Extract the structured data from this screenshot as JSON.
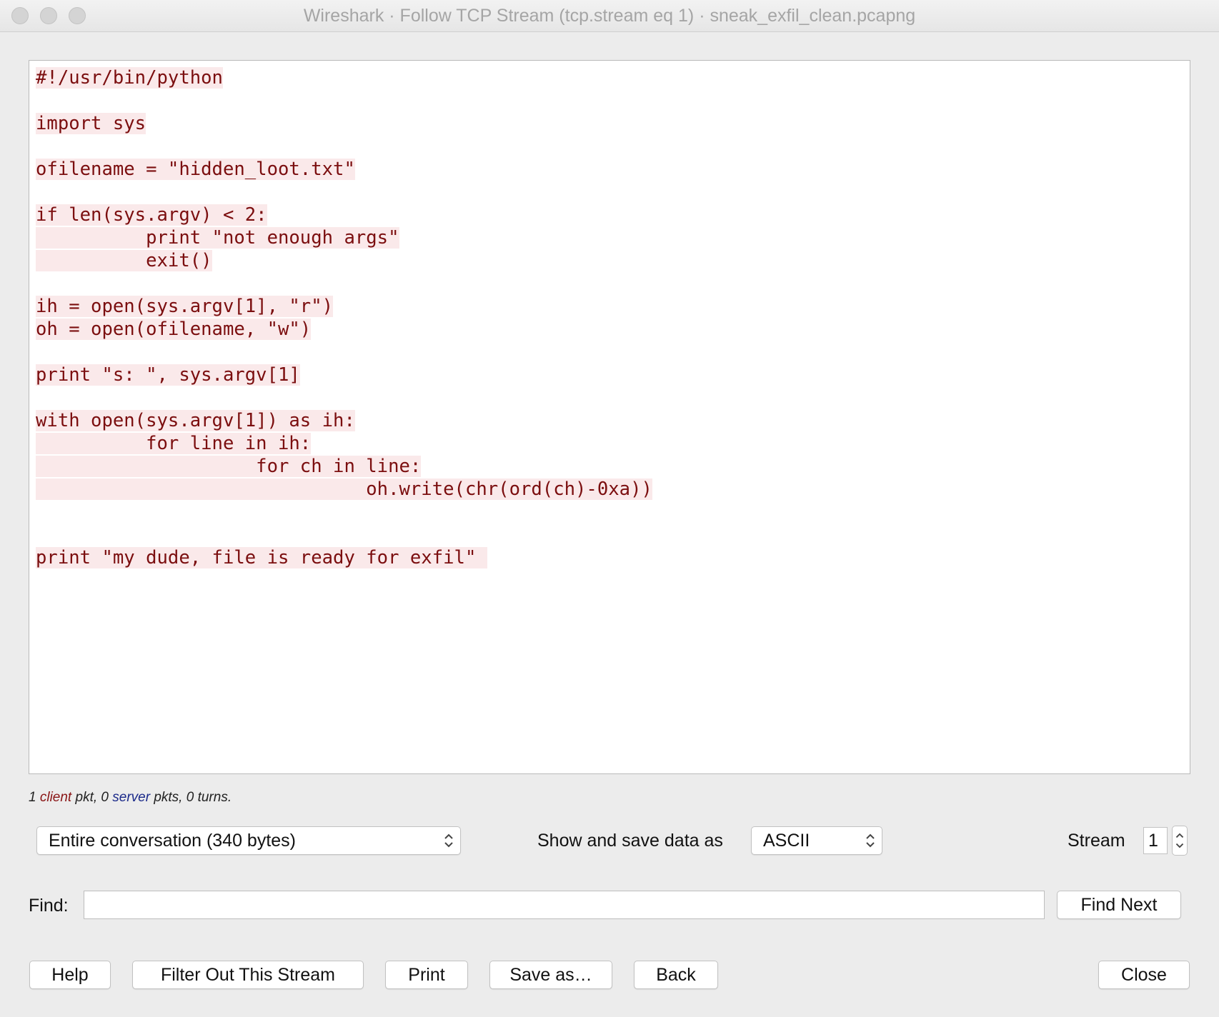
{
  "window": {
    "title": "Wireshark · Follow TCP Stream (tcp.stream eq 1) · sneak_exfil_clean.pcapng"
  },
  "stream_content": {
    "lines": [
      "#!/usr/bin/python",
      "",
      "import sys",
      "",
      "ofilename = \"hidden_loot.txt\"",
      "",
      "if len(sys.argv) < 2:",
      "          print \"not enough args\"",
      "          exit()",
      "",
      "ih = open(sys.argv[1], \"r\")",
      "oh = open(ofilename, \"w\")",
      "",
      "print \"s: \", sys.argv[1]",
      "",
      "with open(sys.argv[1]) as ih:",
      "          for line in ih:",
      "                    for ch in line:",
      "                              oh.write(chr(ord(ch)-0xa))",
      "",
      "",
      "print \"my dude, file is ready for exfil\" "
    ],
    "client_color": "#7b0e0f",
    "client_bg": "#fae9ea"
  },
  "stats": {
    "prefix": "1 ",
    "client": "client",
    "mid1": " pkt, 0 ",
    "server": "server",
    "suffix": " pkts, 0 turns."
  },
  "controls": {
    "conversation_select": "Entire conversation (340 bytes)",
    "show_as_label": "Show and save data as",
    "show_as_select": "ASCII",
    "stream_label": "Stream",
    "stream_value": "1",
    "find_label": "Find:",
    "find_value": "",
    "find_next": "Find Next"
  },
  "buttons": {
    "help": "Help",
    "filter_out": "Filter Out This Stream",
    "print": "Print",
    "save_as": "Save as…",
    "back": "Back",
    "close": "Close"
  }
}
